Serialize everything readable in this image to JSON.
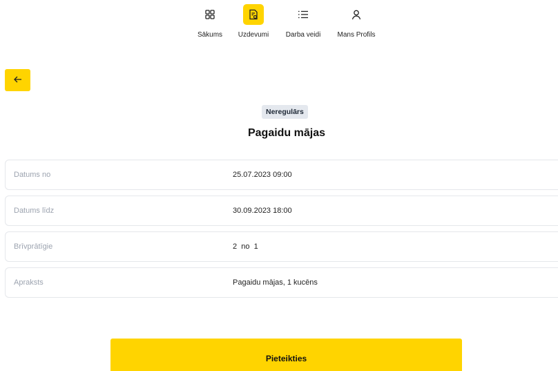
{
  "nav": {
    "items": [
      {
        "label": "Sākums",
        "icon": "grid-icon",
        "active": false
      },
      {
        "label": "Uzdevumi",
        "icon": "task-document-icon",
        "active": true
      },
      {
        "label": "Darba veidi",
        "icon": "list-icon",
        "active": false
      },
      {
        "label": "Mans Profils",
        "icon": "user-icon",
        "active": false
      }
    ]
  },
  "back": {
    "icon": "arrow-left-icon"
  },
  "task": {
    "badge": "Neregulārs",
    "title": "Pagaidu mājas"
  },
  "details": [
    {
      "label": "Datums no",
      "value": "25.07.2023 09:00"
    },
    {
      "label": "Datums līdz",
      "value": "30.09.2023 18:00"
    },
    {
      "label": "Brīvprātīgie",
      "value": "2  no  1"
    },
    {
      "label": "Apraksts",
      "value": "Pagaidu mājas, 1 kucēns"
    }
  ],
  "actions": {
    "apply_label": "Pieteikties"
  },
  "colors": {
    "accent": "#ffd400",
    "badge_bg": "#e4e8ee",
    "border": "#e5e7eb"
  }
}
